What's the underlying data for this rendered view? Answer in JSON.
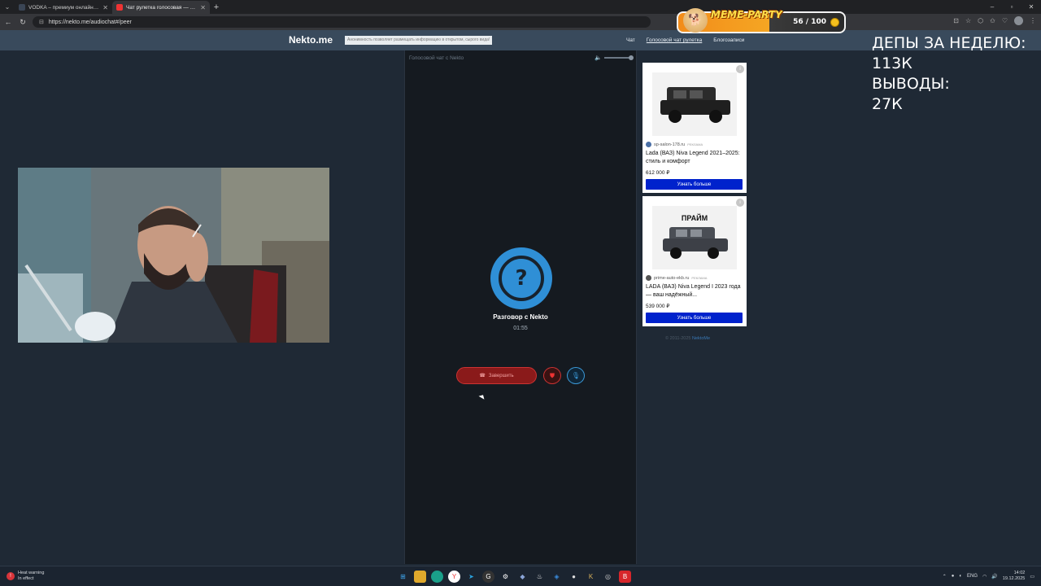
{
  "browser": {
    "tabs": [
      {
        "title": "VODKA – премиум онлайн-казино",
        "active": false
      },
      {
        "title": "Чат рулетка голосовая — Nekto",
        "active": true
      }
    ],
    "url": "https://nekto.me/audiochat#/peer"
  },
  "overlay": {
    "meme_title": "MEME-PARTY",
    "score": "56 / 100",
    "stats_line1": "ДЕПЫ ЗА НЕДЕЛЮ:",
    "stats_line2": "113К",
    "stats_line3": "ВЫВОДЫ:",
    "stats_line4": "27К"
  },
  "site": {
    "logo": "Nekto.me",
    "anon_note": "Анонимность позволяет размещать информацию в открытом, сырого вида!",
    "nav": [
      {
        "label": "Чат"
      },
      {
        "label": "Голосовой чат рулетка"
      },
      {
        "label": "Блогозаписи"
      }
    ]
  },
  "chat": {
    "header": "Голосовой чат с Nekto",
    "title": "Разговор с Nekto",
    "timer": "01:55",
    "end_button": "Завершить"
  },
  "ads": [
    {
      "domain": "sp-salon-178.ru",
      "badge": "реклама",
      "title": "Lada (ВАЗ) Niva Legend 2021–2025: стиль и комфорт",
      "price": "612 000 ₽",
      "cta": "Узнать больше"
    },
    {
      "image_brand": "ПРАЙМ",
      "domain": "prime-auto-ekb.ru",
      "badge": "реклама",
      "title": "LADA (ВАЗ) Niva Legend I 2023 года — ваш надёжный...",
      "price": "539 000 ₽",
      "cta": "Узнать больше"
    }
  ],
  "footer": {
    "copyright": "© 2011-2025",
    "link": "NektoMe"
  },
  "taskbar": {
    "warning_title": "Heat warning",
    "warning_sub": "In effect",
    "lang": "ENG",
    "time": "14:02",
    "date": "19.12.2025"
  }
}
